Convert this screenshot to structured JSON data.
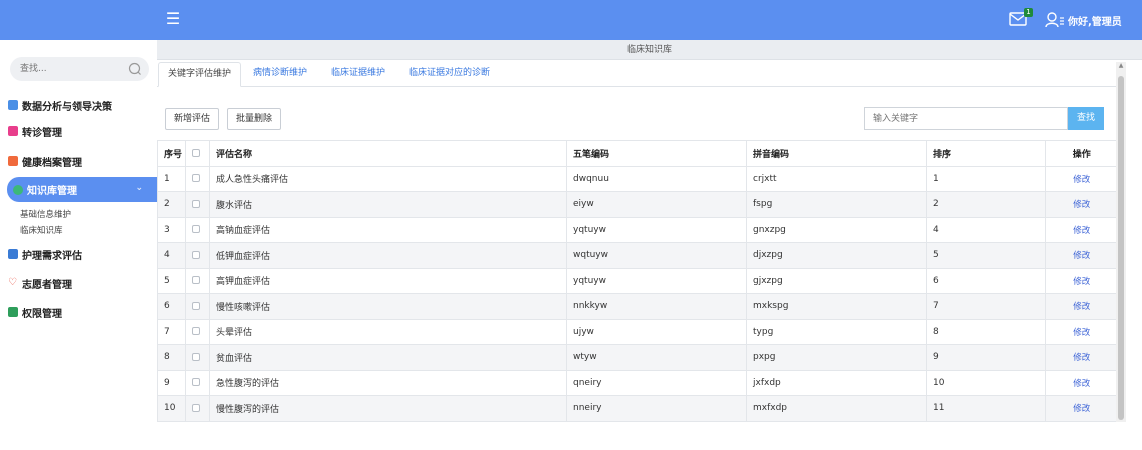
{
  "header": {
    "mail_badge": "1",
    "greeting": "你好,管理员"
  },
  "sidebar": {
    "search_placeholder": "查找...",
    "items": [
      {
        "label": "数据分析与领导决策",
        "color": "#4a8fe6"
      },
      {
        "label": "转诊管理",
        "color": "#e83e8c"
      },
      {
        "label": "健康档案管理",
        "color": "#f06a3c"
      },
      {
        "label": "知识库管理",
        "color": "#3cb878"
      },
      {
        "label": "护理需求评估",
        "color": "#3a7bd5"
      },
      {
        "label": "志愿者管理",
        "color": "#e74c3c"
      },
      {
        "label": "权限管理",
        "color": "#2e9e5b"
      }
    ],
    "subitems": [
      {
        "label": "基础信息维护"
      },
      {
        "label": "临床知识库"
      }
    ]
  },
  "breadcrumb": "临床知识库",
  "tabs": [
    {
      "label": "关键字评估维护"
    },
    {
      "label": "病情诊断维护"
    },
    {
      "label": "临床证据维护"
    },
    {
      "label": "临床证据对应的诊断"
    }
  ],
  "toolbar": {
    "add_label": "新增评估",
    "batch_delete_label": "批量删除",
    "keyword_placeholder": "输入关键字",
    "search_label": "查找"
  },
  "table": {
    "columns": [
      "序号",
      "评估名称",
      "五笔编码",
      "拼音编码",
      "排序",
      "操作"
    ],
    "edit_label": "修改",
    "rows": [
      {
        "no": "1",
        "name": "成人急性头痛评估",
        "wubi": "dwqnuu",
        "pinyin": "crjxtt",
        "order": "1"
      },
      {
        "no": "2",
        "name": "腹水评估",
        "wubi": "eiyw",
        "pinyin": "fspg",
        "order": "2"
      },
      {
        "no": "3",
        "name": "高钠血症评估",
        "wubi": "yqtuyw",
        "pinyin": "gnxzpg",
        "order": "4"
      },
      {
        "no": "4",
        "name": "低钾血症评估",
        "wubi": "wqtuyw",
        "pinyin": "djxzpg",
        "order": "5"
      },
      {
        "no": "5",
        "name": "高钾血症评估",
        "wubi": "yqtuyw",
        "pinyin": "gjxzpg",
        "order": "6"
      },
      {
        "no": "6",
        "name": "慢性咳嗽评估",
        "wubi": "nnkkyw",
        "pinyin": "mxkspg",
        "order": "7"
      },
      {
        "no": "7",
        "name": "头晕评估",
        "wubi": "ujyw",
        "pinyin": "typg",
        "order": "8"
      },
      {
        "no": "8",
        "name": "贫血评估",
        "wubi": "wtyw",
        "pinyin": "pxpg",
        "order": "9"
      },
      {
        "no": "9",
        "name": "急性腹泻的评估",
        "wubi": "qneiry",
        "pinyin": "jxfxdp",
        "order": "10"
      },
      {
        "no": "10",
        "name": "慢性腹泻的评估",
        "wubi": "nneiry",
        "pinyin": "mxfxdp",
        "order": "11"
      }
    ]
  }
}
